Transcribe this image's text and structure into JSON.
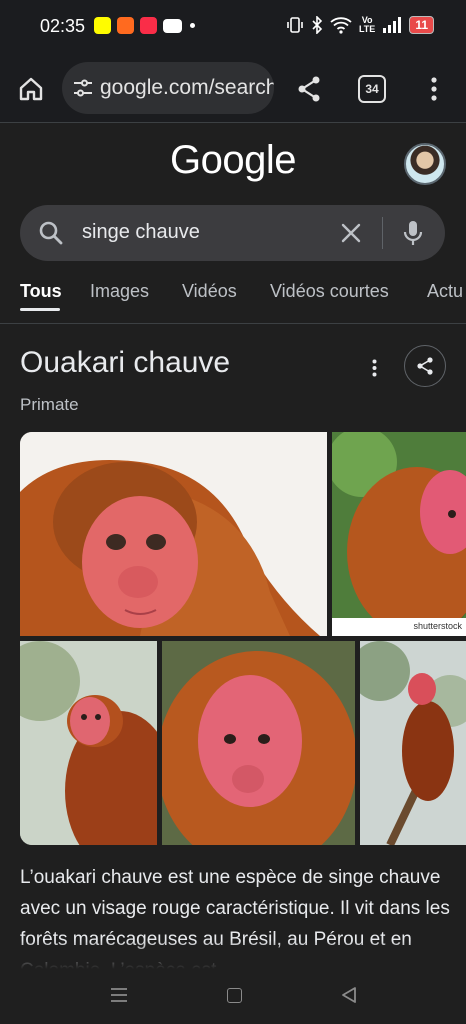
{
  "status_bar": {
    "time": "02:35",
    "battery": "11",
    "network_label": "Vo\nLTE",
    "notification_icons": [
      "snapchat-icon",
      "app-icon",
      "music-icon",
      "youtube-icon"
    ]
  },
  "browser": {
    "url": "google.com/search",
    "tab_count": "34"
  },
  "header": {
    "logo": "Google"
  },
  "search": {
    "query": "singe chauve"
  },
  "tabs": [
    {
      "label": "Tous",
      "active": true
    },
    {
      "label": "Images"
    },
    {
      "label": "Vidéos"
    },
    {
      "label": "Vidéos courtes"
    },
    {
      "label": "Actu"
    }
  ],
  "knowledge_panel": {
    "title": "Ouakari chauve",
    "subtitle": "Primate",
    "image_watermark": "shutterstock",
    "description": "L’ouakari chauve est une espèce de singe chauve avec un visage rouge caractéristique. Il vit dans les forêts marécageuses au Brésil, au Pérou et en Colombie. L’espèce est"
  },
  "colors": {
    "background": "#1f1f1f",
    "search_box": "#3c3c3f",
    "battery_low": "#e94a4a",
    "monkey_fur": "#b3551f",
    "monkey_face": "#e0606a"
  }
}
